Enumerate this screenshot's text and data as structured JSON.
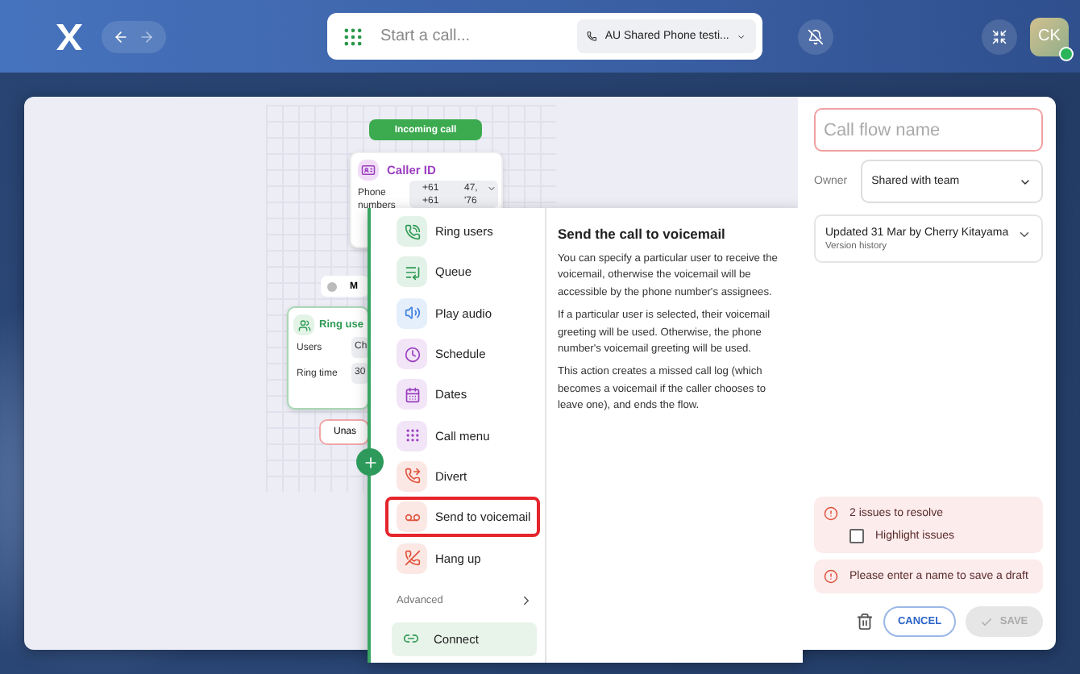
{
  "topbar": {
    "search_placeholder": "Start a call...",
    "phone_line": "AU Shared Phone testi...",
    "notifications_muted": true,
    "avatar": {
      "initials": "CK",
      "online": true
    }
  },
  "canvas": {
    "incoming_call": {
      "label": "Incoming call"
    },
    "caller_id": {
      "title": "Caller ID",
      "field_label": "Phone numbers",
      "values": [
        "+61",
        "47,",
        "+61",
        "'76"
      ]
    },
    "mini_node": {
      "label": "M"
    },
    "ring_users": {
      "title": "Ring use",
      "fields": [
        {
          "label": "Users",
          "value": "Ch"
        },
        {
          "label": "Ring time",
          "value": "30"
        }
      ]
    },
    "branch_button": {
      "label": "Unas"
    }
  },
  "menu": {
    "items": [
      {
        "kind": "ring",
        "label": "Ring users",
        "color": "#2f9a55",
        "selected": false
      },
      {
        "kind": "queue",
        "label": "Queue",
        "color": "#2f9a55",
        "selected": false
      },
      {
        "kind": "audio",
        "label": "Play audio",
        "color": "#3b7fe0",
        "selected": false
      },
      {
        "kind": "schedule",
        "label": "Schedule",
        "color": "#9a3fc0",
        "selected": false
      },
      {
        "kind": "dates",
        "label": "Dates",
        "color": "#9a3fc0",
        "selected": false
      },
      {
        "kind": "callmenu",
        "label": "Call menu",
        "color": "#9a3fc0",
        "selected": false
      },
      {
        "kind": "divert",
        "label": "Divert",
        "color": "#e0533d",
        "selected": false
      },
      {
        "kind": "voicemail",
        "label": "Send to voicemail",
        "color": "#e0533d",
        "selected": true
      },
      {
        "kind": "hangup",
        "label": "Hang up",
        "color": "#e0533d",
        "selected": false
      }
    ],
    "advanced": "Advanced",
    "connect": "Connect"
  },
  "description": {
    "title": "Send the call to voicemail",
    "paragraphs": [
      "You can specify a particular user to receive the voicemail, otherwise the voicemail will be accessible by the phone number's assignees.",
      "If a particular user is selected, their voicemail greeting will be used. Otherwise, the phone number's voicemail greeting will be used.",
      "This action creates a missed call log (which becomes a voicemail if the caller chooses to leave one), and ends the flow."
    ]
  },
  "panel": {
    "name_placeholder": "Call flow name",
    "name_invalid": true,
    "owner_label": "Owner",
    "owner_value": "Shared with team",
    "version": {
      "updated": "Updated 31 Mar by Cherry Kitayama",
      "link": "Version history"
    },
    "issues": {
      "title": "2 issues to resolve",
      "highlight_label": "Highlight issues",
      "highlight_checked": false
    },
    "error": "Please enter a name to save a draft",
    "cancel": "CANCEL",
    "save": {
      "label": "SAVE",
      "disabled": true
    }
  }
}
